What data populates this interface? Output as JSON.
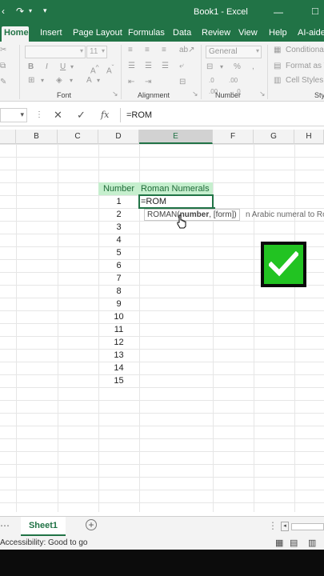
{
  "title_bar": {
    "title": "Book1 - Excel"
  },
  "tabs": [
    "Home",
    "Insert",
    "Page Layout",
    "Formulas",
    "Data",
    "Review",
    "View",
    "Help",
    "AI-aided"
  ],
  "ribbon": {
    "font_name": "",
    "font_size": "11",
    "number_format": "General",
    "conditional_label": "Conditiona",
    "format_as_label": "Format as T",
    "cell_styles_label": "Cell Styles",
    "groups": {
      "font": "Font",
      "alignment": "Alignment",
      "number": "Number",
      "styles": "Sty"
    }
  },
  "formula_bar": {
    "fx_label": "fx",
    "content": "=ROM"
  },
  "columns": [
    "B",
    "C",
    "D",
    "E",
    "F",
    "G",
    "H"
  ],
  "table": {
    "header_number": "Number",
    "header_roman": "Roman Numerals",
    "numbers": [
      "1",
      "2",
      "3",
      "4",
      "5",
      "6",
      "7",
      "8",
      "9",
      "10",
      "11",
      "12",
      "13",
      "14",
      "15"
    ],
    "active_cell_text": "=ROM"
  },
  "tooltip": {
    "fn_name": "ROMAN(",
    "arg_bold": "number",
    "arg_rest": ", [form])",
    "description": "n Arabic numeral to Roma"
  },
  "sheet_tab": "Sheet1",
  "status": {
    "accessibility": "Accessibility: Good to go"
  },
  "colors": {
    "excel_green": "#217346",
    "header_fill": "#c6efce",
    "check_green": "#22c322"
  }
}
